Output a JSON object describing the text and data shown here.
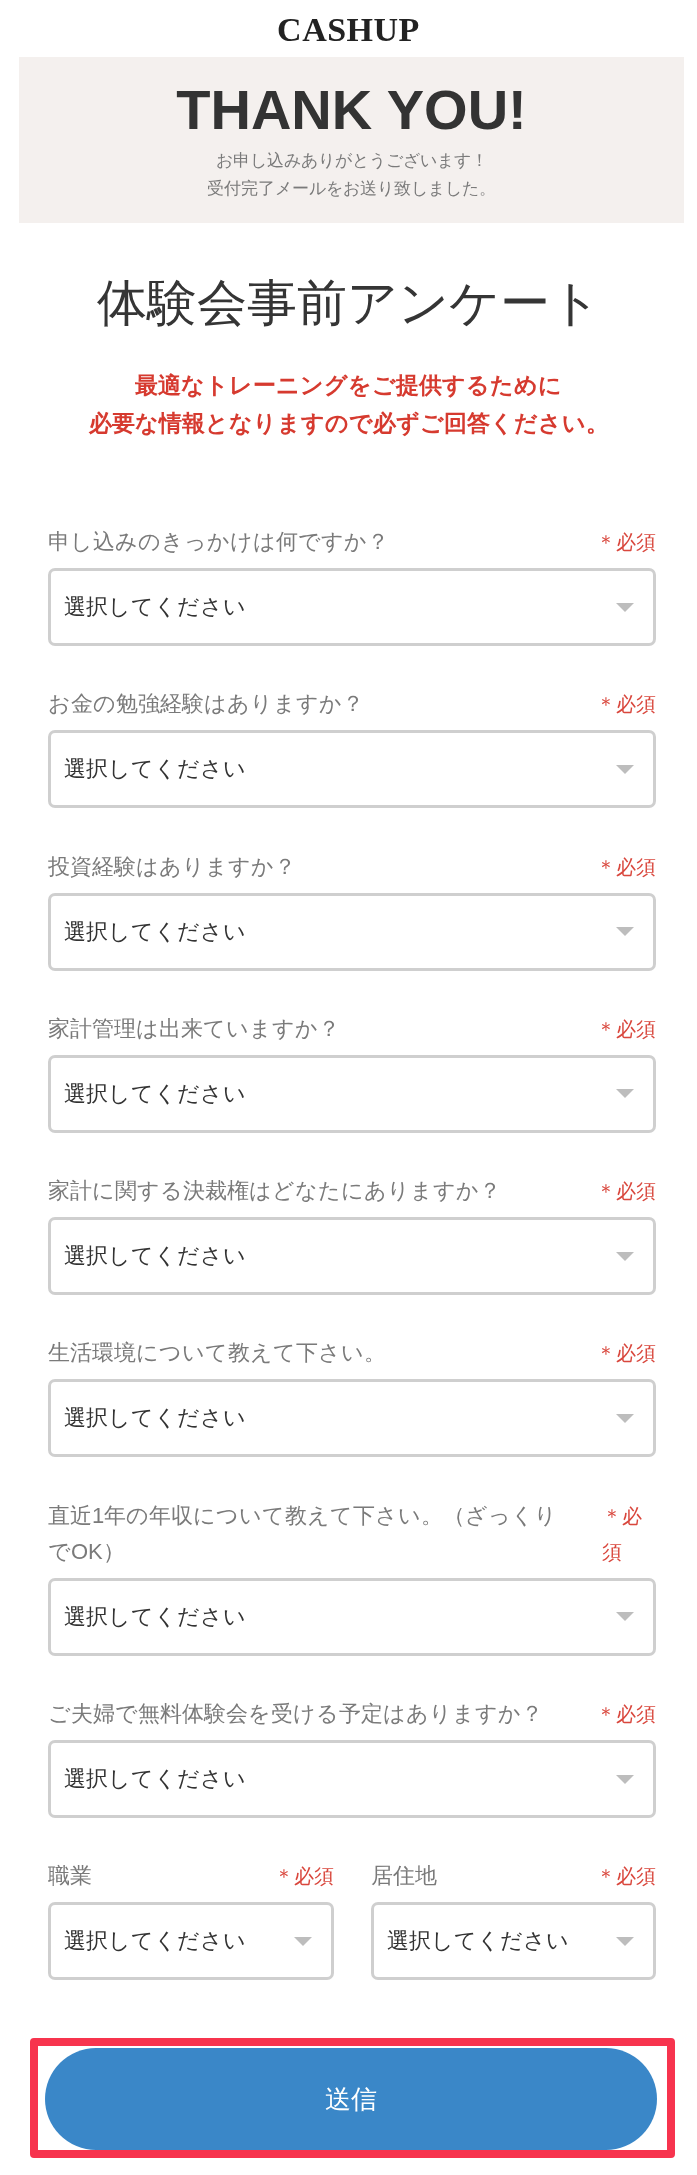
{
  "header": {
    "logo": "CASHUP"
  },
  "thanks_banner": {
    "heading": "THANK YOU!",
    "message_lines": [
      "お申し込みありがとうございます！",
      "受付完了メールをお送り致しました。"
    ]
  },
  "survey": {
    "title": "体験会事前アンケート",
    "notice_lines": [
      "最適なトレーニングをご提供するために",
      "必要な情報となりますので必ずご回答ください。"
    ]
  },
  "questions": [
    {
      "label": "申し込みのきっかけは何ですか？",
      "required_mark": "＊必須",
      "placeholder": "選択してください"
    },
    {
      "label": "お金の勉強経験はありますか？",
      "required_mark": "＊必須",
      "placeholder": "選択してください"
    },
    {
      "label": "投資経験はありますか？",
      "required_mark": "＊必須",
      "placeholder": "選択してください"
    },
    {
      "label": "家計管理は出来ていますか？",
      "required_mark": "＊必須",
      "placeholder": "選択してください"
    },
    {
      "label": "家計に関する決裁権はどなたにありますか？",
      "required_mark": "＊必須",
      "placeholder": "選択してください"
    },
    {
      "label": "生活環境について教えて下さい。",
      "required_mark": "＊必須",
      "placeholder": "選択してください"
    },
    {
      "label": "直近1年の年収について教えて下さい。（ざっくりでOK）",
      "required_mark": "＊必須",
      "placeholder": "選択してください"
    },
    {
      "label": "ご夫婦で無料体験会を受ける予定はありますか？",
      "required_mark": "＊必須",
      "placeholder": "選択してください"
    }
  ],
  "paired_questions": [
    {
      "label": "職業",
      "required_mark": "＊必須",
      "placeholder": "選択してください"
    },
    {
      "label": "居住地",
      "required_mark": "＊必須",
      "placeholder": "選択してください"
    }
  ],
  "submit_button": {
    "label": "送信",
    "highlighted": true
  }
}
